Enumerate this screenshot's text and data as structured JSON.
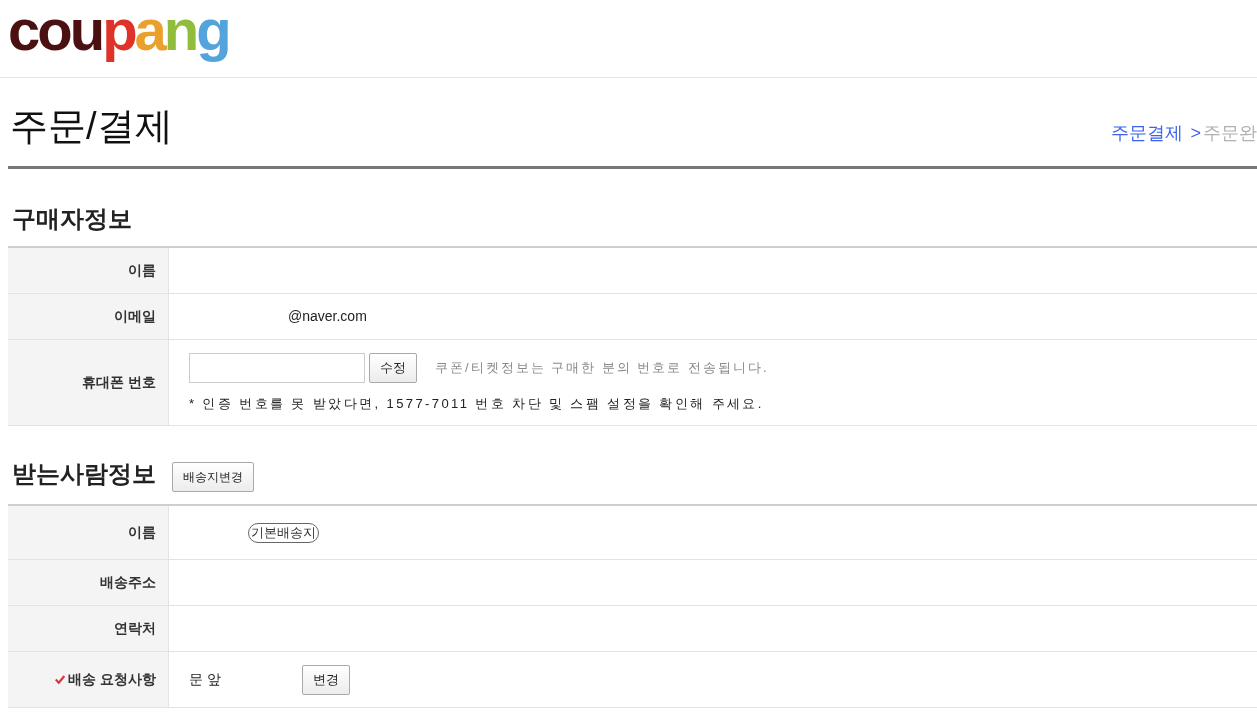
{
  "logo": [
    {
      "text": "cou",
      "color": "#4b1012"
    },
    {
      "text": "p",
      "color": "#df3229"
    },
    {
      "text": "a",
      "color": "#eba02c"
    },
    {
      "text": "n",
      "color": "#90bd3b"
    },
    {
      "text": "g",
      "color": "#53a3dd"
    }
  ],
  "page_title": "주문/결제",
  "breadcrumb": {
    "separator": ">",
    "steps": [
      {
        "label": "주문결제",
        "selected": true
      },
      {
        "label": "주문완",
        "selected": false
      }
    ]
  },
  "sections": [
    {
      "title": "구매자정보",
      "rows": [
        {
          "kind": "text",
          "label": "이름",
          "required": false
        },
        {
          "kind": "email",
          "label": "이메일",
          "required": false,
          "value": "@naver.com"
        },
        {
          "kind": "phone",
          "label": "휴대폰 번호",
          "required": false,
          "button": "수정",
          "hint": "쿠폰/티켓정보는 구매한 분의 번호로 전송됩니다.",
          "note": "* 인증 번호를 못 받았다면, 1577-7011 번호 차단 및 스팸 설정을 확인해 주세요."
        }
      ]
    },
    {
      "title": "받는사람정보",
      "button": "배송지변경",
      "rows": [
        {
          "kind": "badge",
          "label": "이름",
          "required": false,
          "badge": "기본배송지"
        },
        {
          "kind": "text",
          "label": "배송주소",
          "required": false
        },
        {
          "kind": "text",
          "label": "연락처",
          "required": false
        },
        {
          "kind": "request",
          "label": "배송 요청사항",
          "required": true,
          "value": "문 앞",
          "button": "변경"
        }
      ]
    }
  ]
}
